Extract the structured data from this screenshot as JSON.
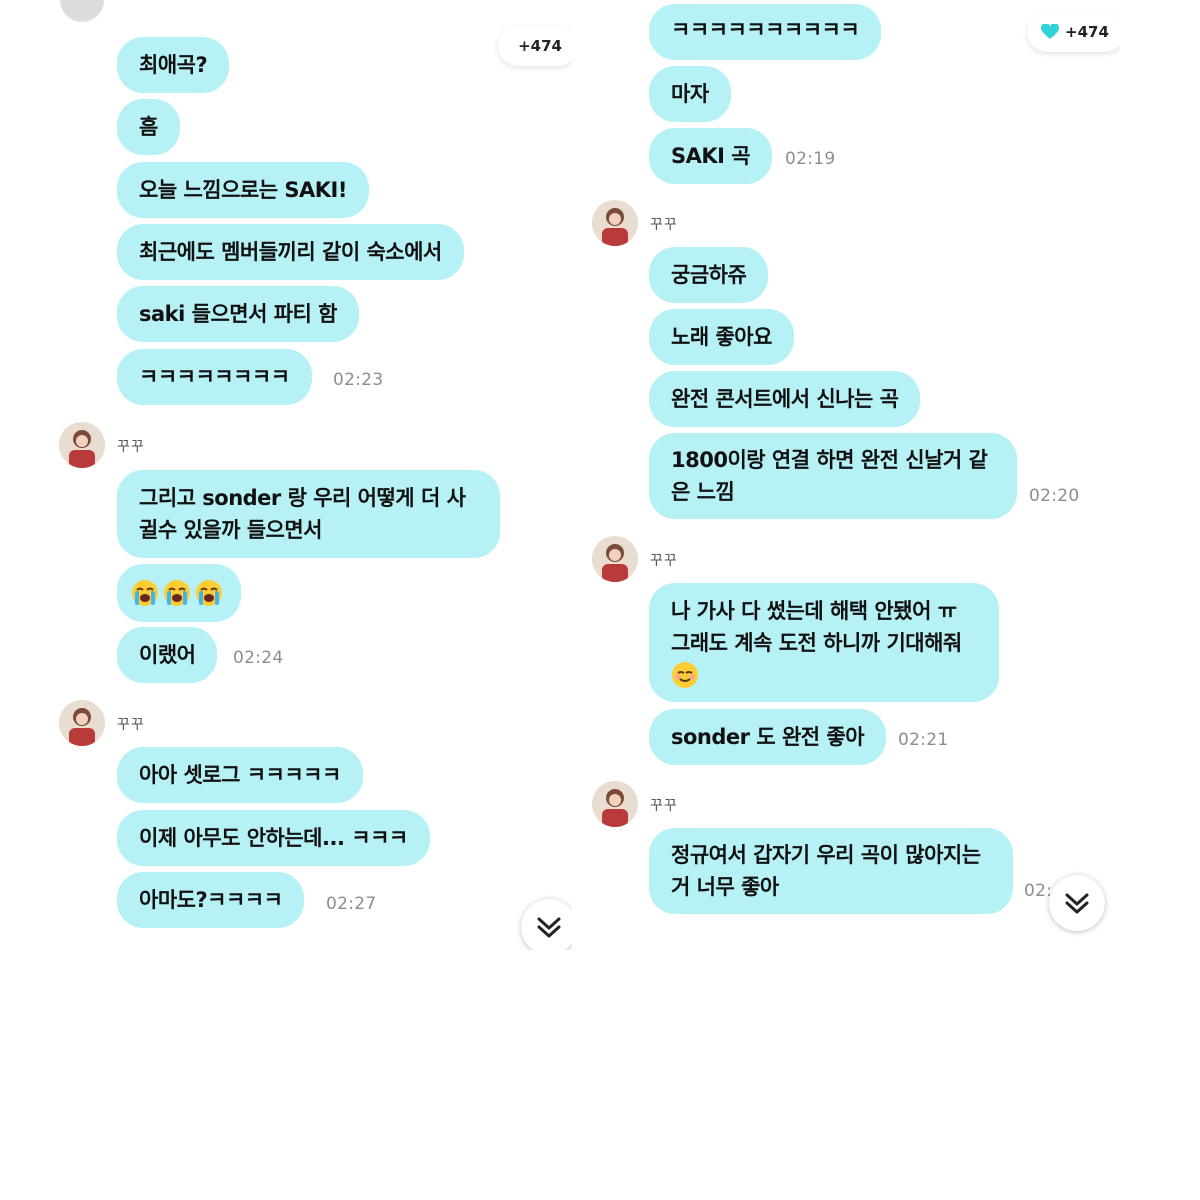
{
  "left": {
    "hearts": "+474",
    "messages": [
      {
        "text": "최애곡?"
      },
      {
        "text": "흠"
      },
      {
        "text": "오늘 느낌으로는 SAKI!"
      },
      {
        "text": "최근에도 멤버들끼리 같이 숙소에서"
      },
      {
        "text": "saki 들으면서 파티 함"
      },
      {
        "text": "ㅋㅋㅋㅋㅋㅋㅋㅋ",
        "time": "02:23"
      },
      {
        "sender": "꾸꾸"
      },
      {
        "text": "그리고 sonder  랑 우리 어떻게 더 사귈수 있을까 들으면서"
      },
      {
        "emoji": [
          "loudly-crying-face-emoji",
          "loudly-crying-face-emoji",
          "loudly-crying-face-emoji"
        ]
      },
      {
        "text": "이랬어",
        "time": "02:24"
      },
      {
        "sender": "꾸꾸"
      },
      {
        "text": "아아 셋로그 ㅋㅋㅋㅋㅋ"
      },
      {
        "text": "이제 아무도 안하는데... ㅋㅋㅋ"
      },
      {
        "text": "아마도?ㅋㅋㅋㅋ",
        "time": "02:27"
      }
    ]
  },
  "right": {
    "hearts": "+474",
    "messages": [
      {
        "text": "ㅋㅋㅋㅋㅋㅋㅋㅋㅋㅋ"
      },
      {
        "text": "마자"
      },
      {
        "text": "SAKI 곡",
        "time": "02:19"
      },
      {
        "sender": "꾸꾸"
      },
      {
        "text": "궁금하쥬"
      },
      {
        "text": "노래 좋아요"
      },
      {
        "text": "완전 콘서트에서 신나는 곡"
      },
      {
        "text": "1800이랑 연결 하면 완전 신날거 같은 느낌",
        "time": "02:20"
      },
      {
        "sender": "꾸꾸"
      },
      {
        "text": "나 가사 다 썼는데 해택 안됐어 ㅠ 그래도 계속 도전 하니까 기대해줘",
        "emoji": "smiling-face-emoji"
      },
      {
        "text": "sonder 도 완전 좋아",
        "time": "02:21"
      },
      {
        "sender": "꾸꾸"
      },
      {
        "text": "정규여서 갑자기 우리 곡이 많아지는 거 너무 좋아",
        "time": "02:"
      }
    ]
  },
  "colors": {
    "bubble": "#b6f1f6",
    "heart": "#2fd3d6",
    "timestamp": "#8d8d8d"
  },
  "icons": [
    "heart-icon",
    "double-chevron-down-icon",
    "avatar"
  ]
}
